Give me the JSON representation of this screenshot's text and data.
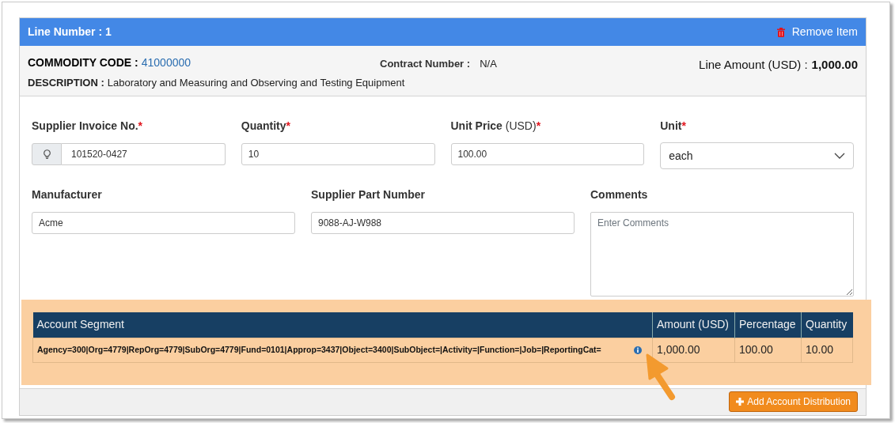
{
  "header": {
    "title": "Line Number : 1",
    "remove_button": "Remove Item"
  },
  "summary": {
    "commodity_label": "COMMODITY CODE :",
    "commodity_code": "41000000",
    "description_label": "DESCRIPTION :",
    "description": "Laboratory and Measuring and Observing and Testing Equipment",
    "contract_label": "Contract Number :",
    "contract_value": "N/A",
    "amount_label": "Line Amount (USD) :",
    "amount_value": "1,000.00"
  },
  "fields_row_1": [
    {
      "kind": "addon",
      "label": "Supplier Invoice No.",
      "required_mark": "*",
      "value": "101520-0427"
    },
    {
      "kind": "text",
      "label": "Quantity",
      "required_mark": "*",
      "value": "10"
    },
    {
      "kind": "text",
      "label": "Unit Price",
      "unit": "(USD)",
      "required_mark": "*",
      "value": "100.00"
    },
    {
      "kind": "select",
      "label": "Unit",
      "required_mark": "*",
      "value": "each"
    }
  ],
  "fields_row_2": [
    {
      "kind": "text",
      "label": "Manufacturer",
      "value": "Acme"
    },
    {
      "kind": "text",
      "label": "Supplier Part Number",
      "value": "9088-AJ-W988"
    },
    {
      "kind": "textarea",
      "label": "Comments",
      "placeholder": "Enter Comments"
    }
  ],
  "table": {
    "columns": [
      "Account Segment",
      "Amount (USD)",
      "Percentage",
      "Quantity"
    ],
    "rows": [
      [
        "Agency=300|Org=4779|RepOrg=4779|SubOrg=4779|Fund=0101|Approp=3437|Object=3400|SubObject=|Activity=|Function=|Job=|ReportingCat=",
        "1,000.00",
        "100.00",
        "10.00"
      ]
    ]
  },
  "footer": {
    "button": "Add Account Distribution"
  }
}
